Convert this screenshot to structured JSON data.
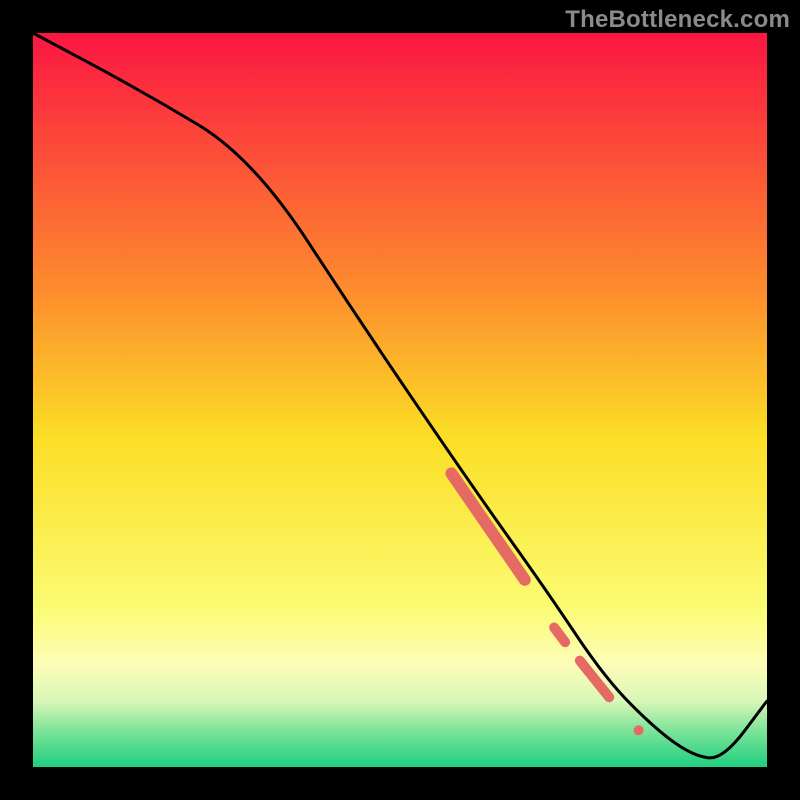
{
  "watermark": "TheBottleneck.com",
  "chart_data": {
    "type": "line",
    "title": "",
    "xlabel": "",
    "ylabel": "",
    "xlim": [
      0,
      100
    ],
    "ylim": [
      0,
      100
    ],
    "gradient_stops": [
      {
        "offset": 0.0,
        "color": "#fb1642"
      },
      {
        "offset": 0.35,
        "color": "#fd8c2e"
      },
      {
        "offset": 0.55,
        "color": "#fbde25"
      },
      {
        "offset": 0.78,
        "color": "#fbfb72"
      },
      {
        "offset": 0.86,
        "color": "#fdfdb8"
      },
      {
        "offset": 0.91,
        "color": "#d9f7b8"
      },
      {
        "offset": 0.95,
        "color": "#7ee499"
      },
      {
        "offset": 1.0,
        "color": "#1ecf80"
      }
    ],
    "curve": {
      "x": [
        0,
        15,
        30,
        45,
        60,
        70,
        78,
        85,
        90,
        94,
        100
      ],
      "y": [
        100,
        92,
        83,
        60,
        38,
        24,
        12,
        5,
        1.5,
        1,
        9
      ]
    },
    "highlight_segments": [
      {
        "x0": 57.0,
        "y0": 40.0,
        "x1": 67.0,
        "y1": 25.5,
        "width": 12
      },
      {
        "x0": 71.0,
        "y0": 19.0,
        "x1": 72.5,
        "y1": 17.0,
        "width": 10
      },
      {
        "x0": 74.5,
        "y0": 14.5,
        "x1": 78.5,
        "y1": 9.5,
        "width": 10
      }
    ],
    "highlight_dots": [
      {
        "x": 82.5,
        "y": 5.0,
        "r": 5
      }
    ],
    "highlight_color": "#e66a64"
  }
}
